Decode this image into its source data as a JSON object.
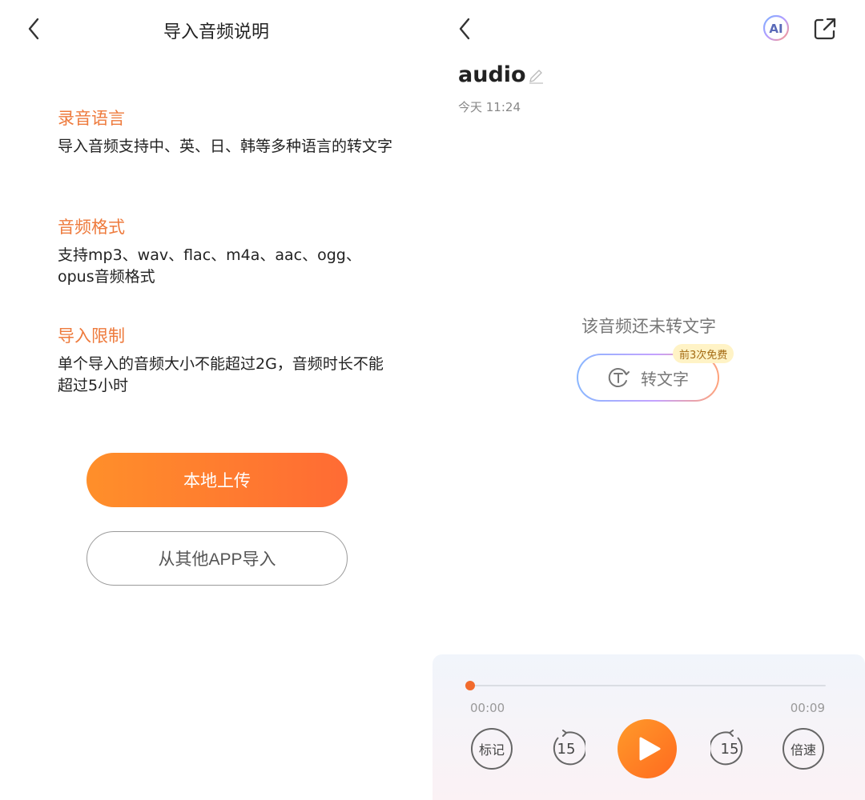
{
  "left_screen": {
    "title": "导入音频说明",
    "sections": [
      {
        "heading": "录音语言",
        "body": "导入音频支持中、英、日、韩等多种语言的转文字"
      },
      {
        "heading": "音频格式",
        "body": "支持mp3、wav、flac、m4a、aac、ogg、opus音频格式"
      },
      {
        "heading": "导入限制",
        "body": "单个导入的音频大小不能超过2G，音频时长不能超过5小时"
      }
    ],
    "upload_label": "本地上传",
    "import_label": "从其他APP导入"
  },
  "right_screen": {
    "ai_label": "AI",
    "audio_title": "audio",
    "timestamp": "今天 11:24",
    "empty_text": "该音频还未转文字",
    "convert_label": "转文字",
    "free_badge": "前3次免费",
    "player": {
      "current_time": "00:00",
      "total_time": "00:09",
      "progress": 0,
      "mark_label": "标记",
      "rewind_label": "15",
      "forward_label": "15",
      "speed_label": "倍速"
    }
  },
  "colors": {
    "accent": "#ee7a3c",
    "primary_button_start": "#ff8f2a",
    "primary_button_end": "#ff6b34",
    "progress": "#f26b2d"
  },
  "icons": [
    "back-icon",
    "ai-icon",
    "share-icon",
    "edit-icon",
    "text-convert-icon",
    "rewind-15-icon",
    "play-icon",
    "forward-15-icon"
  ]
}
